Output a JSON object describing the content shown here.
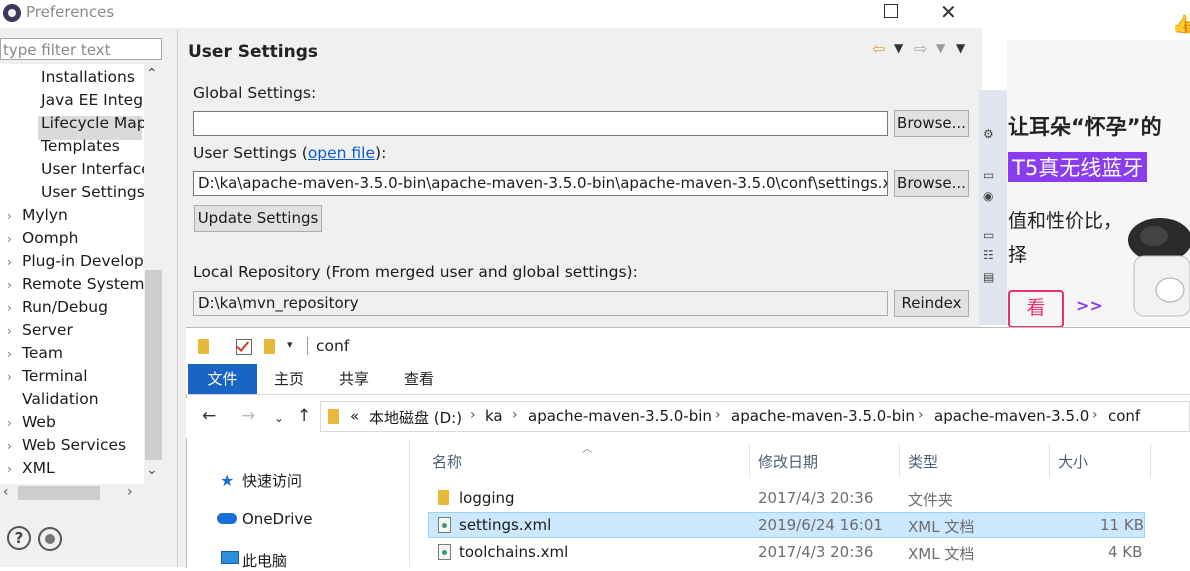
{
  "preferences": {
    "title": "Preferences",
    "filter_placeholder": "type filter text",
    "tree_items": [
      {
        "label": "Installations",
        "expandable": false
      },
      {
        "label": "Java EE Integra",
        "expandable": false
      },
      {
        "label": "Lifecycle Mapp",
        "expandable": false
      },
      {
        "label": "Templates",
        "expandable": false
      },
      {
        "label": "User Interface",
        "expandable": false
      },
      {
        "label": "User Settings",
        "expandable": false,
        "selected": true
      },
      {
        "label": "Mylyn",
        "expandable": true
      },
      {
        "label": "Oomph",
        "expandable": true
      },
      {
        "label": "Plug-in Develop",
        "expandable": true
      },
      {
        "label": "Remote Systems",
        "expandable": true
      },
      {
        "label": "Run/Debug",
        "expandable": true
      },
      {
        "label": "Server",
        "expandable": true
      },
      {
        "label": "Team",
        "expandable": true
      },
      {
        "label": "Terminal",
        "expandable": true
      },
      {
        "label": "Validation",
        "expandable": false
      },
      {
        "label": "Web",
        "expandable": true
      },
      {
        "label": "Web Services",
        "expandable": true
      },
      {
        "label": "XML",
        "expandable": true
      }
    ],
    "page_title": "User Settings",
    "global_settings_label": "Global Settings:",
    "global_settings_value": "",
    "browse_label": "Browse...",
    "user_settings_label_prefix": "User Settings (",
    "open_file_link": "open file",
    "user_settings_label_suffix": "):",
    "user_settings_value": "D:\\ka\\apache-maven-3.5.0-bin\\apache-maven-3.5.0-bin\\apache-maven-3.5.0\\conf\\settings.xml",
    "update_settings_label": "Update Settings",
    "local_repo_label": "Local Repository (From merged user and global settings):",
    "local_repo_value": "D:\\ka\\mvn_repository",
    "reindex_label": "Reindex"
  },
  "ad": {
    "line1": "让耳朵“怀孕”的",
    "line2": "T5真无线蓝牙",
    "line3": "值和性价比，",
    "line4": "择",
    "button": "看",
    "arrows": ">>",
    "colors": {
      "pink": "#e8336d",
      "purple": "#8a3cf0"
    }
  },
  "explorer": {
    "window_title": "conf",
    "ribbon_tabs": [
      "文件",
      "主页",
      "共享",
      "查看"
    ],
    "breadcrumbs": [
      "«",
      "本地磁盘 (D:)",
      "ka",
      "apache-maven-3.5.0-bin",
      "apache-maven-3.5.0-bin",
      "apache-maven-3.5.0",
      "conf"
    ],
    "nav_pane": [
      "快速访问",
      "OneDrive",
      "此电脑"
    ],
    "columns": [
      "名称",
      "修改日期",
      "类型",
      "大小"
    ],
    "files": [
      {
        "name": "logging",
        "date": "2017/4/3 20:36",
        "type": "文件夹",
        "size": "",
        "icon": "folder-icon"
      },
      {
        "name": "settings.xml",
        "date": "2019/6/24 16:01",
        "type": "XML 文档",
        "size": "11 KB",
        "icon": "xml-file-icon",
        "selected": true
      },
      {
        "name": "toolchains.xml",
        "date": "2017/4/3 20:36",
        "type": "XML 文档",
        "size": "4 KB",
        "icon": "xml-file-icon"
      }
    ],
    "accent": "#1a64c3",
    "selection": "#cce8ff"
  }
}
